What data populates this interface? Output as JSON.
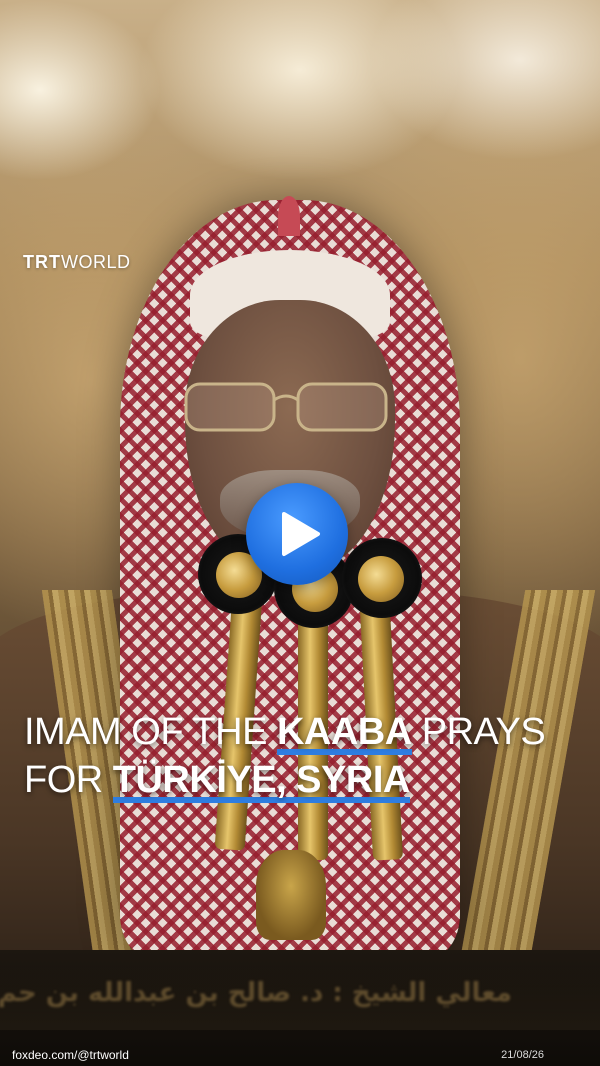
{
  "logo": {
    "trt": "TRT",
    "world": "WORLD"
  },
  "play_button": {
    "icon": "play-icon",
    "color": "#1f6fe0"
  },
  "headline": {
    "line1_prefix": "IMAM OF THE ",
    "line1_emphasis": "KAABA",
    "line1_suffix": " PRAYS",
    "line2_prefix": "FOR ",
    "line2_emphasis": "TÜRKİYE, SYRIA",
    "accent_color": "#2e7de0"
  },
  "caption": {
    "arabic_text": "معالي الشيخ : د. صالح بن عبدالله بن حم"
  },
  "footer": {
    "handle": "foxdeo.com/@trtworld",
    "date": "21/08/26"
  }
}
